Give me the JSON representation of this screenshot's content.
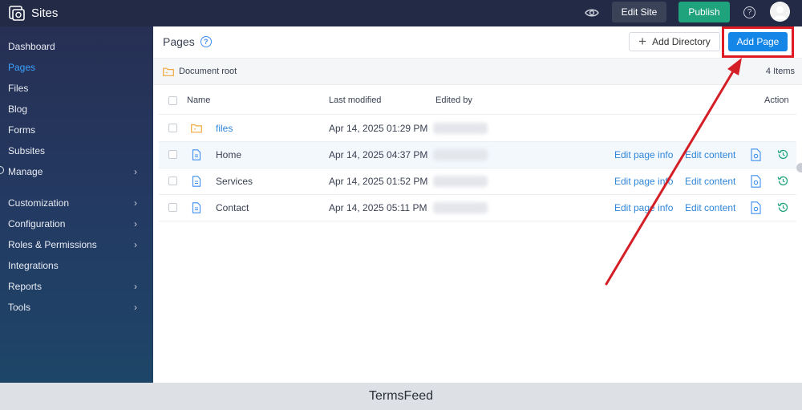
{
  "topbar": {
    "app_title": "Sites",
    "edit_site_label": "Edit Site",
    "publish_label": "Publish",
    "help_glyph": "?",
    "colors": {
      "bar": "#222a45",
      "publish": "#1fa37c"
    }
  },
  "sidebar": {
    "items": [
      {
        "label": "Dashboard",
        "active": false,
        "has_chevron": false
      },
      {
        "label": "Pages",
        "active": true,
        "has_chevron": false
      },
      {
        "label": "Files",
        "active": false,
        "has_chevron": false
      },
      {
        "label": "Blog",
        "active": false,
        "has_chevron": false
      },
      {
        "label": "Forms",
        "active": false,
        "has_chevron": false
      },
      {
        "label": "Subsites",
        "active": false,
        "has_chevron": false
      },
      {
        "label": "Manage",
        "active": false,
        "has_chevron": true
      },
      {
        "label": "Customization",
        "active": false,
        "has_chevron": true
      },
      {
        "label": "Configuration",
        "active": false,
        "has_chevron": true
      },
      {
        "label": "Roles & Permissions",
        "active": false,
        "has_chevron": true
      },
      {
        "label": "Integrations",
        "active": false,
        "has_chevron": false
      },
      {
        "label": "Reports",
        "active": false,
        "has_chevron": true
      },
      {
        "label": "Tools",
        "active": false,
        "has_chevron": true
      }
    ]
  },
  "main": {
    "title": "Pages",
    "help_glyph": "?",
    "add_directory_label": "Add Directory",
    "add_page_label": "Add Page",
    "root_label": "Document root",
    "items_count": "4 Items",
    "columns": {
      "name": "Name",
      "last_modified": "Last modified",
      "edited_by": "Edited by",
      "action": "Action"
    },
    "rows": [
      {
        "name": "files",
        "type": "folder",
        "modified": "Apr 14, 2025 01:29 PM",
        "edit_info": "",
        "edit_content": ""
      },
      {
        "name": "Home",
        "type": "page",
        "modified": "Apr 14, 2025 04:37 PM",
        "edit_info": "Edit page info",
        "edit_content": "Edit content"
      },
      {
        "name": "Services",
        "type": "page",
        "modified": "Apr 14, 2025 01:52 PM",
        "edit_info": "Edit page info",
        "edit_content": "Edit content"
      },
      {
        "name": "Contact",
        "type": "page",
        "modified": "Apr 14, 2025 05:11 PM",
        "edit_info": "Edit page info",
        "edit_content": "Edit content"
      }
    ]
  },
  "annotation": {
    "color": "#e01b24"
  },
  "footer": {
    "text": "TermsFeed"
  }
}
